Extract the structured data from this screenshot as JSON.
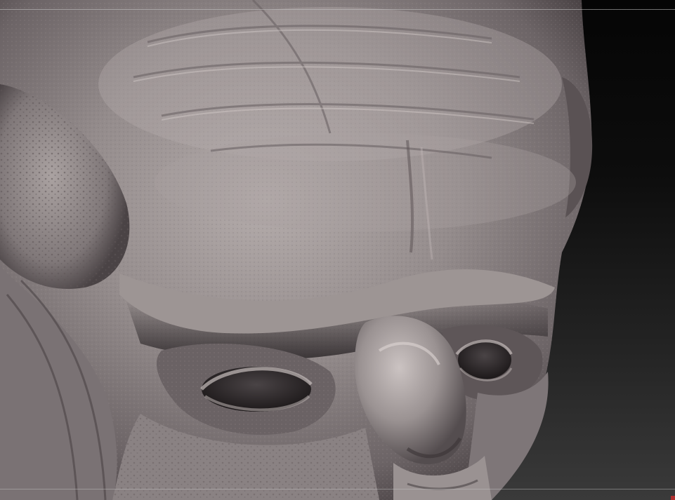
{
  "viewport": {
    "background_top": "#050505",
    "background_bottom": "#3a3a3a",
    "guide_line_color": "#c8c8c8",
    "corner_marker_color": "#b03030"
  },
  "model": {
    "subject": "sculpted-creature-head",
    "material_color": "#8f8788",
    "highlight_color": "#cfc7c6",
    "shadow_color": "#2a2527"
  }
}
